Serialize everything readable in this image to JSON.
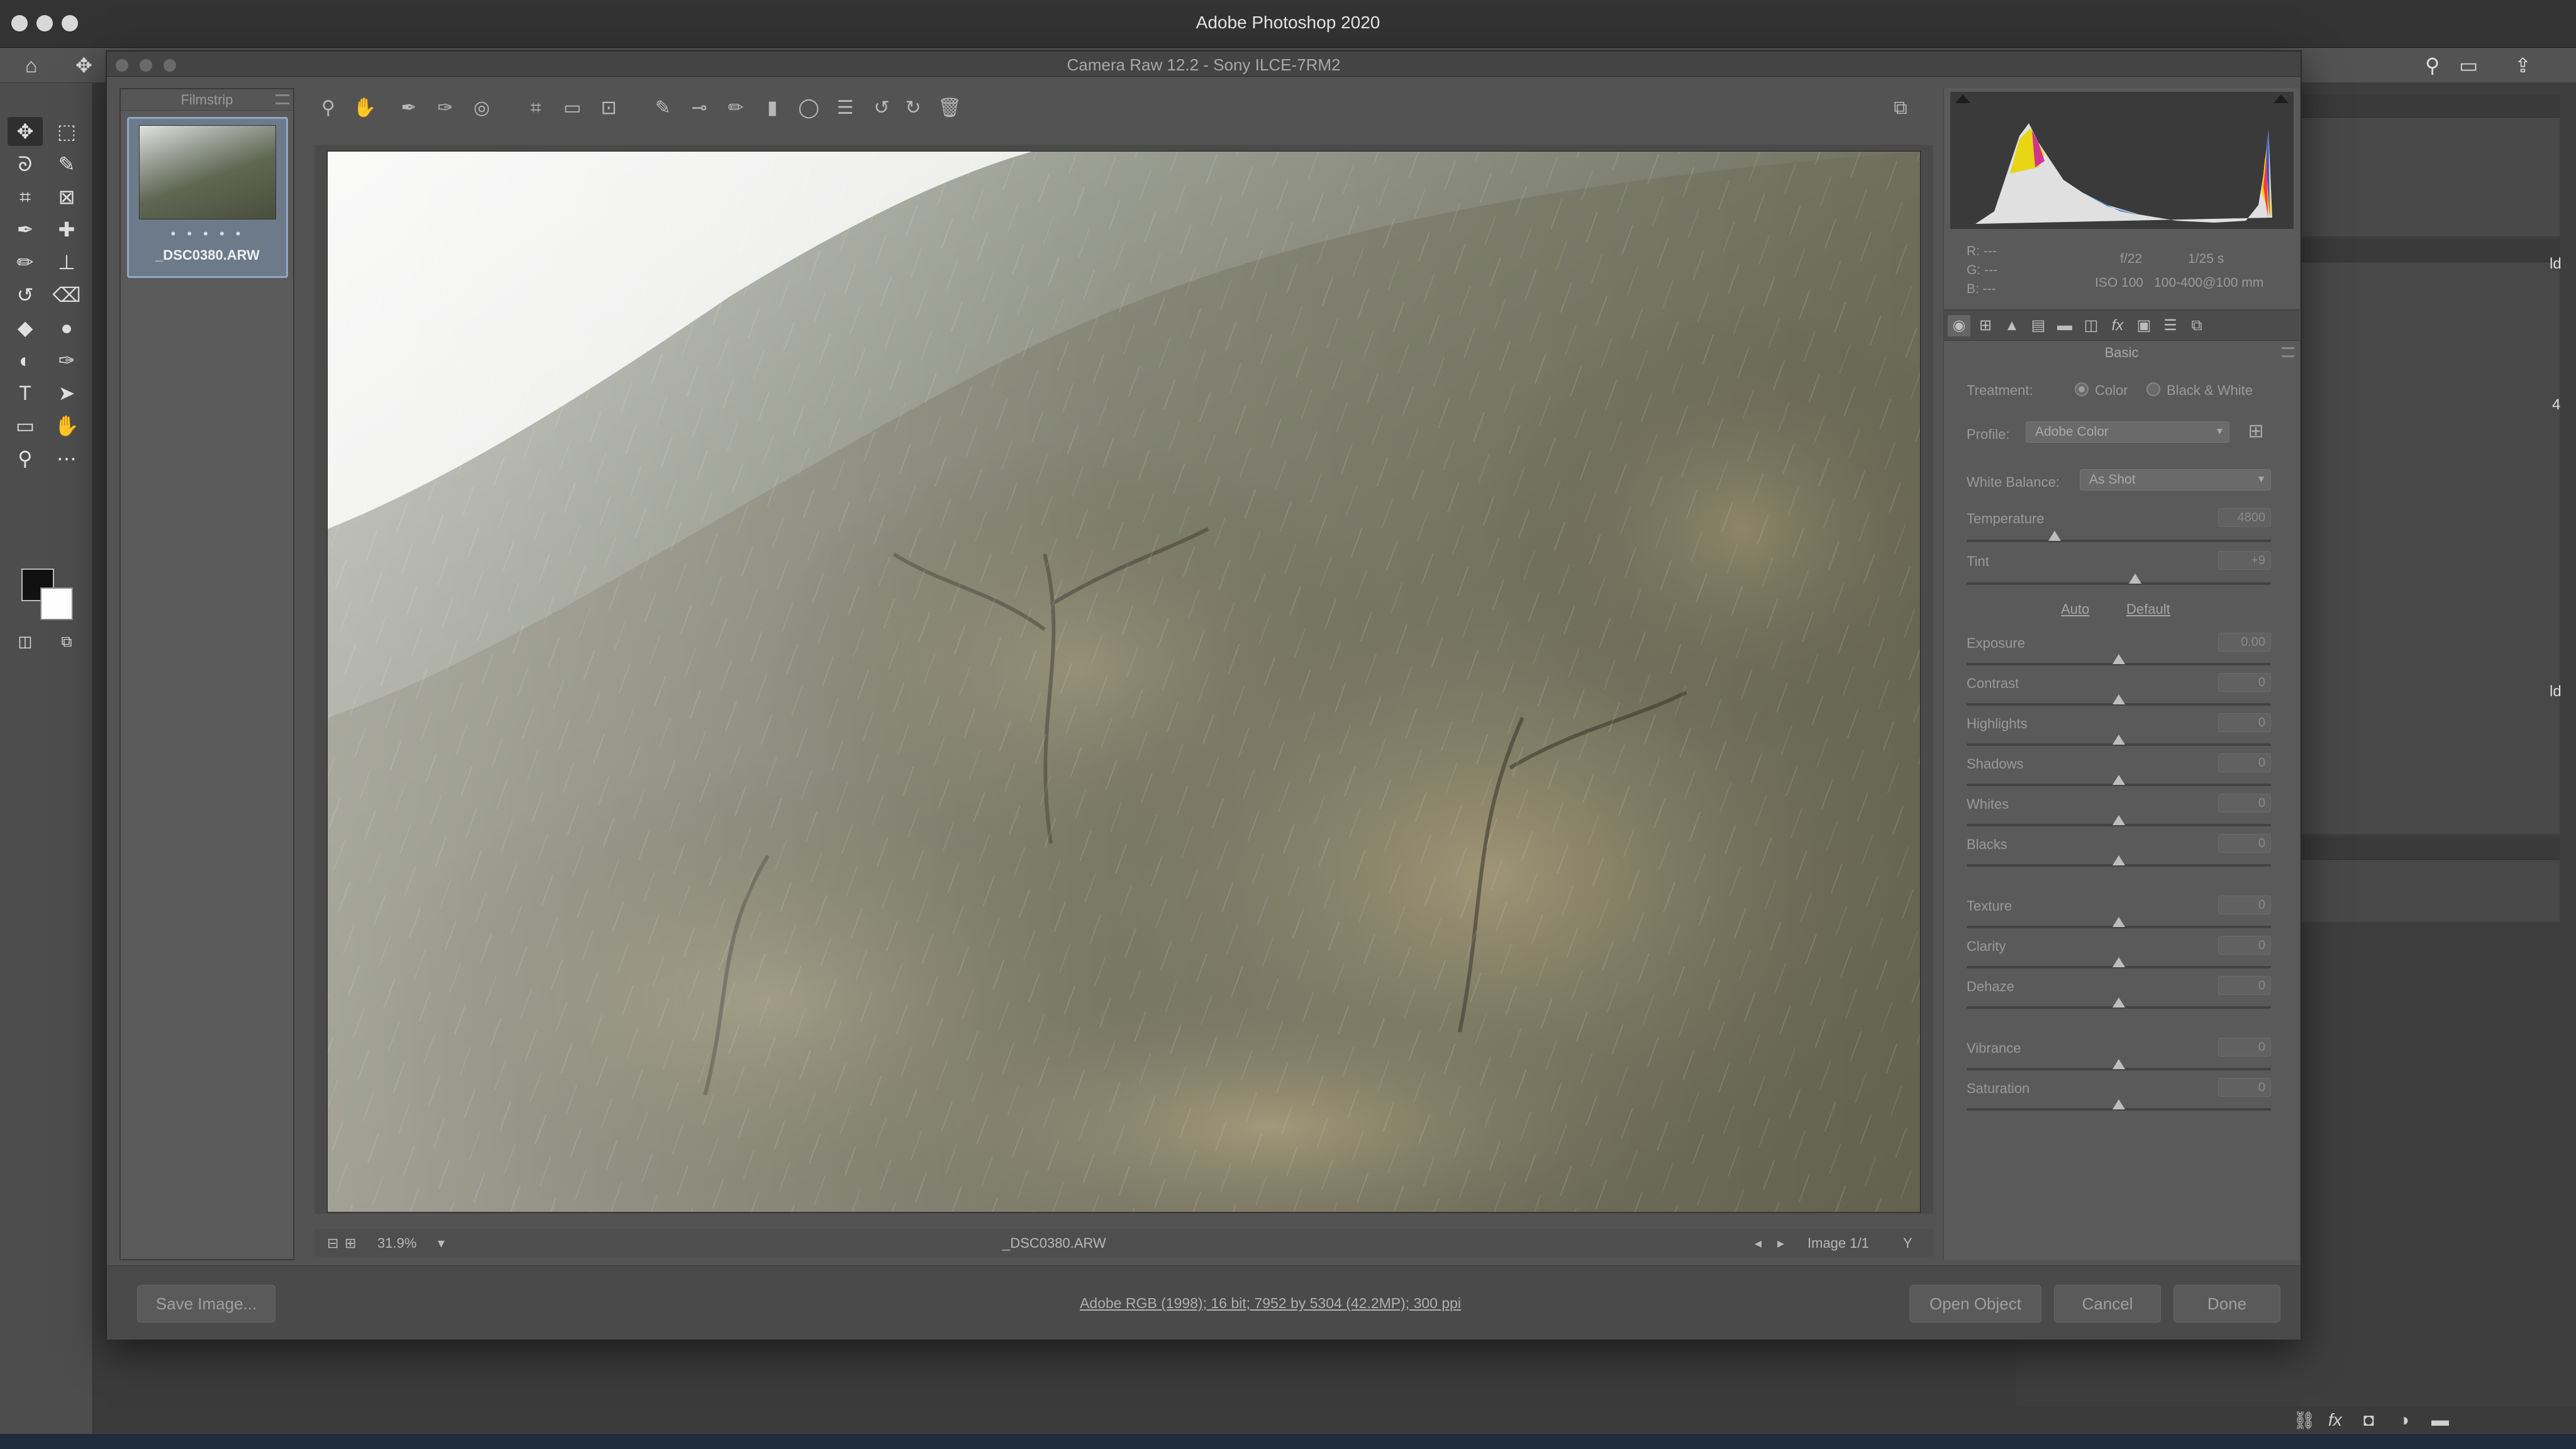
{
  "mac": {
    "app_title": "Adobe Photoshop 2020"
  },
  "acr": {
    "title": "Camera Raw 12.2 - Sony ILCE-7RM2",
    "filmstrip": {
      "header": "Filmstrip",
      "file_name": "_DSC0380.ARW",
      "rating": "• • • • •"
    },
    "preview": {
      "zoom": "31.9%",
      "file_name": "_DSC0380.ARW",
      "image_count": "Image 1/1"
    },
    "bottom": {
      "save_label": "Save Image...",
      "workflow": "Adobe RGB (1998); 16 bit; 7952 by 5304 (42.2MP); 300 ppi",
      "open_label": "Open Object",
      "cancel_label": "Cancel",
      "done_label": "Done"
    },
    "histogram_info": {
      "r": "R:  ---",
      "g": "G:  ---",
      "b": "B:  ---",
      "aperture": "f/22",
      "shutter": "1/25 s",
      "iso": "ISO 100",
      "lens": "100-400@100 mm"
    },
    "basic": {
      "title": "Basic",
      "treatment_label": "Treatment:",
      "treatment_color": "Color",
      "treatment_bw": "Black & White",
      "profile_label": "Profile:",
      "profile_value": "Adobe Color",
      "wb_label": "White Balance:",
      "wb_value": "As Shot",
      "auto": "Auto",
      "default": "Default",
      "sliders": [
        {
          "label": "Temperature",
          "value": "4800"
        },
        {
          "label": "Tint",
          "value": "+9"
        },
        {
          "label": "Exposure",
          "value": "0.00"
        },
        {
          "label": "Contrast",
          "value": "0"
        },
        {
          "label": "Highlights",
          "value": "0"
        },
        {
          "label": "Shadows",
          "value": "0"
        },
        {
          "label": "Whites",
          "value": "0"
        },
        {
          "label": "Blacks",
          "value": "0"
        },
        {
          "label": "Texture",
          "value": "0"
        },
        {
          "label": "Clarity",
          "value": "0"
        },
        {
          "label": "Dehaze",
          "value": "0"
        },
        {
          "label": "Vibrance",
          "value": "0"
        },
        {
          "label": "Saturation",
          "value": "0"
        }
      ]
    }
  },
  "ps_dock": {
    "side_text_1": "4",
    "side_text_2": "ld",
    "side_text_3": "ld"
  },
  "status_icons": {
    "link": "⛓",
    "fx": "fx"
  }
}
